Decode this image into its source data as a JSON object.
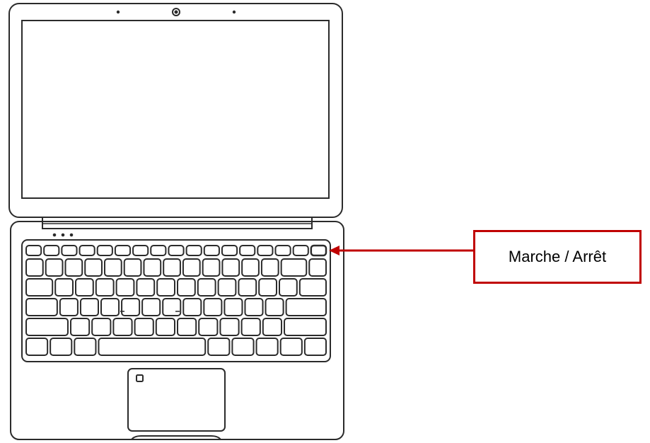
{
  "callout": {
    "label": "Marche / Arrêt",
    "target": "power-button",
    "color": "#c00000"
  },
  "laptop": {
    "stroke_color": "#333333",
    "keyboard": {
      "function_row_keys": 17,
      "rows": [
        [
          "key",
          "key",
          "key",
          "key",
          "key",
          "key",
          "key",
          "key",
          "key",
          "key",
          "key",
          "key",
          "key",
          "wide",
          "key"
        ],
        [
          "wide",
          "key",
          "key",
          "key",
          "key",
          "key",
          "key",
          "key",
          "key",
          "key",
          "key",
          "key",
          "key",
          "wide"
        ],
        [
          "wider",
          "key",
          "key",
          "key",
          "key",
          "key",
          "key",
          "key",
          "key",
          "key",
          "key",
          "key",
          "widest"
        ],
        [
          "widest",
          "key",
          "key",
          "key",
          "key",
          "key",
          "key",
          "key",
          "key",
          "key",
          "key",
          "widest"
        ],
        [
          "key",
          "key",
          "key",
          "space",
          "key",
          "key",
          "key",
          "key",
          "key"
        ]
      ]
    },
    "touchpad_icon": "square-icon",
    "indicator_dots": 3
  }
}
